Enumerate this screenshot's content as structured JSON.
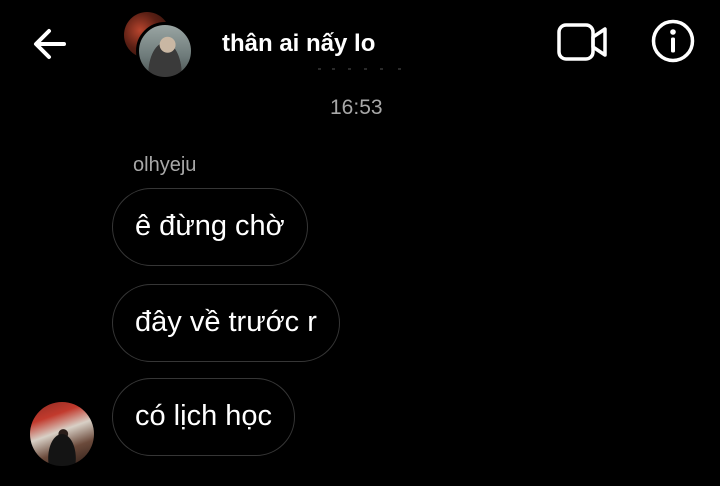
{
  "header": {
    "contact_name": "thân ai nấy lo",
    "back_icon": "arrow-left-icon",
    "video_icon": "video-camera-icon",
    "info_icon": "info-icon"
  },
  "thread": {
    "timestamp": "16:53",
    "sender_name": "olhyeju",
    "messages": [
      {
        "text": "ê đừng chờ"
      },
      {
        "text": "đây về trước r"
      },
      {
        "text": "có lịch học"
      }
    ]
  },
  "colors": {
    "background": "#000000",
    "text": "#ffffff",
    "secondary_text": "#a8a8a8",
    "bubble_border": "#363636"
  }
}
